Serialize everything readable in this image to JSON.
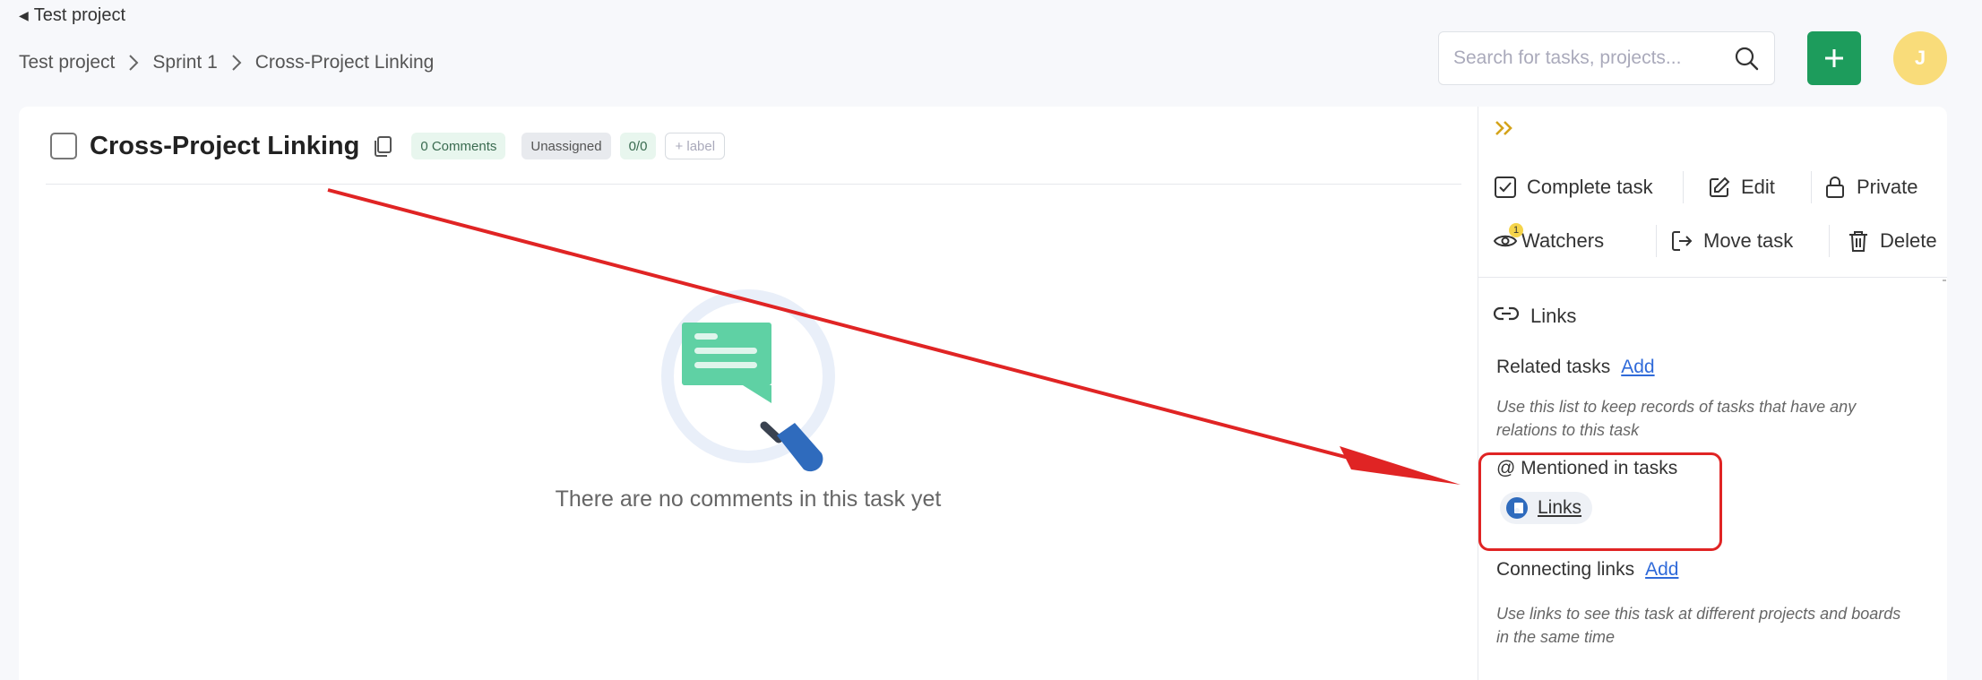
{
  "header": {
    "back_label": "Test project",
    "breadcrumb": [
      "Test project",
      "Sprint 1",
      "Cross-Project Linking"
    ],
    "search_placeholder": "Search for tasks, projects...",
    "avatar_initial": "J"
  },
  "task": {
    "title": "Cross-Project Linking",
    "comments_pill": "0 Comments",
    "assignee_pill": "Unassigned",
    "progress_pill": "0/0",
    "label_pill": "+ label",
    "empty_text": "There are no comments in this task yet"
  },
  "sidebar": {
    "actions": {
      "complete": "Complete task",
      "edit": "Edit",
      "private": "Private",
      "watchers": "Watchers",
      "watchers_count": "1",
      "move": "Move task",
      "delete": "Delete"
    },
    "links_title": "Links",
    "related": {
      "title": "Related tasks",
      "add": "Add",
      "hint": "Use this list to keep records of tasks that have any relations to this task"
    },
    "mentioned": {
      "title": "@ Mentioned in tasks",
      "chip": "Links"
    },
    "connecting": {
      "title": "Connecting links",
      "add": "Add",
      "hint": "Use links to see this task at different projects and boards in the same time"
    }
  },
  "colors": {
    "accent_green": "#1d9c5c",
    "avatar_yellow": "#f9dc7a",
    "link_blue": "#2f6ad9",
    "annotation_red": "#e02424"
  }
}
